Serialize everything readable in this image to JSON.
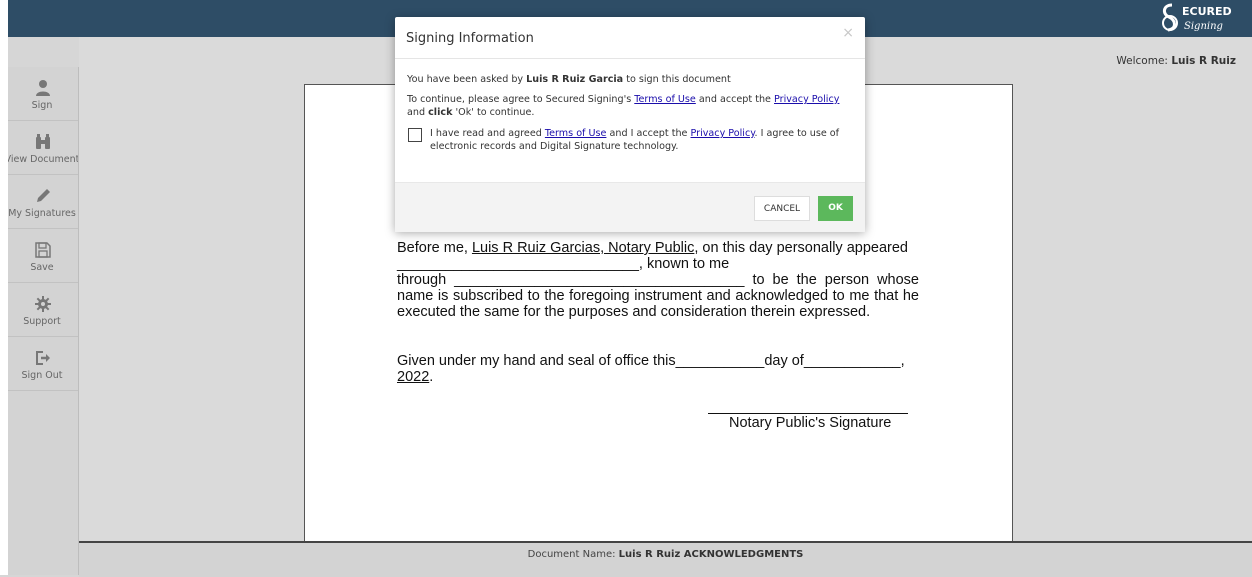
{
  "header": {
    "logo_text": "SECURED Signing",
    "welcome_prefix": "Welcome:",
    "welcome_user": "Luis R Ruiz"
  },
  "sidebar": {
    "items": [
      {
        "label": "Sign",
        "icon": "user-icon"
      },
      {
        "label": "View Document",
        "icon": "binoculars-icon"
      },
      {
        "label": "My Signatures",
        "icon": "pencil-icon"
      },
      {
        "label": "Save",
        "icon": "save-icon"
      },
      {
        "label": "Support",
        "icon": "gear-icon"
      },
      {
        "label": "Sign Out",
        "icon": "sign-out-icon"
      }
    ]
  },
  "document": {
    "p1_before": "Before me,",
    "p1_notary": "Luis R Ruiz Garcias, Notary Public",
    "p1_after": ", on this day personally appeared",
    "line2": "______________________________, known to me",
    "line3": "through ____________________________________ to be the person whose name is subscribed to the foregoing instrument and acknowledged to me that he executed the same for the purposes and consideration therein expressed.",
    "p2_text": "Given under my hand and seal of office this___________day of____________,",
    "p2_year": "2022",
    "p2_end": ".",
    "signature_label": "Notary Public's Signature"
  },
  "footer": {
    "label": "Document Name:",
    "name": "Luis R Ruiz ACKNOWLEDGMENTS"
  },
  "modal": {
    "title": "Signing Information",
    "close": "×",
    "line1_pre": "You have been asked by",
    "requester": "Luis R Ruiz Garcia",
    "line1_post": "to sign this document",
    "line2_pre": "To continue, please agree to Secured Signing's",
    "terms_link": "Terms of Use",
    "line2_mid": "and accept the",
    "privacy_link": "Privacy Policy",
    "line2_and": "and",
    "click_word": "click",
    "line2_post": "'Ok' to continue.",
    "agree_pre": "I have read and agreed",
    "agree_mid": "and I accept the",
    "agree_post": ". I agree to use of electronic records and Digital Signature technology.",
    "cancel_label": "CANCEL",
    "ok_label": "OK"
  },
  "colors": {
    "topbar": "#2e4d66",
    "ok_button": "#5cb85c",
    "link": "#1a0dab"
  }
}
